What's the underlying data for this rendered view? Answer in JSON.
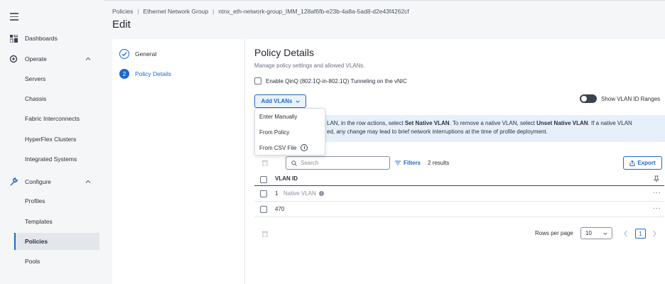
{
  "breadcrumb": [
    "Policies",
    "Ethernet Network Group",
    "ntnx_eth-network-group_IMM_128af6fb-e23b-4a8a-5ad8-d2e43f4262cf"
  ],
  "page_title": "Edit",
  "sidebar": {
    "items": [
      {
        "label": "Dashboards",
        "icon": "dashboard-icon"
      },
      {
        "label": "Operate",
        "icon": "operate-icon",
        "expanded": true
      },
      {
        "label": "Servers"
      },
      {
        "label": "Chassis"
      },
      {
        "label": "Fabric Interconnects"
      },
      {
        "label": "HyperFlex Clusters"
      },
      {
        "label": "Integrated Systems"
      },
      {
        "label": "Configure",
        "icon": "wrench-icon",
        "expanded": true
      },
      {
        "label": "Profiles"
      },
      {
        "label": "Templates"
      },
      {
        "label": "Policies",
        "active": true
      },
      {
        "label": "Pools"
      }
    ]
  },
  "steps": [
    {
      "number": "1",
      "label": "General",
      "status": "done"
    },
    {
      "number": "2",
      "label": "Policy Details",
      "status": "current"
    }
  ],
  "content": {
    "heading": "Policy Details",
    "subtitle": "Manage policy settings and allowed VLANs.",
    "qinq_label": "Enable QinQ (802.1Q-in-802.1Q) Tunneling on the vNIC",
    "add_vlans_label": "Add VLANs",
    "show_ranges_label": "Show VLAN ID Ranges",
    "info_line1_a": "LAN, in the row actions, select ",
    "info_line1_b": "Set Native VLAN",
    "info_line1_c": ". To remove a native VLAN, select ",
    "info_line1_d": "Unset Native VLAN",
    "info_line1_e": ". If a native VLAN",
    "info_line2": "ed, any change may lead to brief network interruptions at the time of profile deployment.",
    "dropdown": [
      "Enter Manually",
      "From Policy",
      "From CSV File"
    ],
    "search_placeholder": "Search",
    "filters_label": "Filters",
    "results": "2 results",
    "export_label": "Export",
    "column_header": "VLAN ID",
    "rows": [
      {
        "vlan_id": "1",
        "tag": "Native VLAN"
      },
      {
        "vlan_id": "470",
        "tag": ""
      }
    ],
    "rows_per_page_label": "Rows per page",
    "rows_per_page_value": "10",
    "current_page": "1"
  },
  "colors": {
    "accent": "#1d69cc",
    "info_bg": "#e6f0fb"
  }
}
